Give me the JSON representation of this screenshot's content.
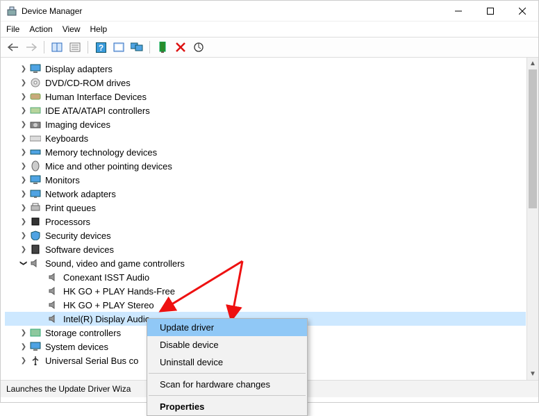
{
  "window": {
    "title": "Device Manager"
  },
  "menubar": [
    "File",
    "Action",
    "View",
    "Help"
  ],
  "toolbar": {
    "back": "back-arrow-icon",
    "forward": "forward-arrow-icon",
    "show_hidden": "show-hidden-icon",
    "properties": "properties-icon",
    "help": "help-icon",
    "scan": "scan-icon",
    "monitor": "second-monitor-icon",
    "add_legacy": "add-legacy-icon",
    "remove": "remove-icon",
    "refresh": "refresh-icon"
  },
  "tree": {
    "nodes": [
      {
        "label": "Display adapters",
        "icon": "monitor-icon"
      },
      {
        "label": "DVD/CD-ROM drives",
        "icon": "disc-icon"
      },
      {
        "label": "Human Interface Devices",
        "icon": "hid-icon"
      },
      {
        "label": "IDE ATA/ATAPI controllers",
        "icon": "ide-icon"
      },
      {
        "label": "Imaging devices",
        "icon": "camera-icon"
      },
      {
        "label": "Keyboards",
        "icon": "keyboard-icon"
      },
      {
        "label": "Memory technology devices",
        "icon": "memory-icon"
      },
      {
        "label": "Mice and other pointing devices",
        "icon": "mouse-icon"
      },
      {
        "label": "Monitors",
        "icon": "monitor-icon"
      },
      {
        "label": "Network adapters",
        "icon": "network-icon"
      },
      {
        "label": "Print queues",
        "icon": "printer-icon"
      },
      {
        "label": "Processors",
        "icon": "cpu-icon"
      },
      {
        "label": "Security devices",
        "icon": "shield-icon"
      },
      {
        "label": "Software devices",
        "icon": "software-icon"
      }
    ],
    "expanded": {
      "label": "Sound, video and game controllers",
      "icon": "speaker-icon",
      "children": [
        {
          "label": "Conexant ISST Audio",
          "icon": "speaker-icon"
        },
        {
          "label": "HK GO + PLAY Hands-Free",
          "icon": "speaker-icon"
        },
        {
          "label": "HK GO + PLAY Stereo",
          "icon": "speaker-icon"
        },
        {
          "label": "Intel(R) Display Audio",
          "icon": "speaker-icon",
          "selected": true
        }
      ]
    },
    "tail": [
      {
        "label": "Storage controllers",
        "icon": "storage-icon"
      },
      {
        "label": "System devices",
        "icon": "system-icon"
      },
      {
        "label": "Universal Serial Bus co",
        "icon": "usb-icon"
      }
    ]
  },
  "context_menu": {
    "items": [
      {
        "label": "Update driver",
        "highlighted": true
      },
      {
        "label": "Disable device"
      },
      {
        "label": "Uninstall device"
      }
    ],
    "scan": "Scan for hardware changes",
    "properties": "Properties"
  },
  "statusbar": {
    "text": "Launches the Update Driver Wiza"
  }
}
